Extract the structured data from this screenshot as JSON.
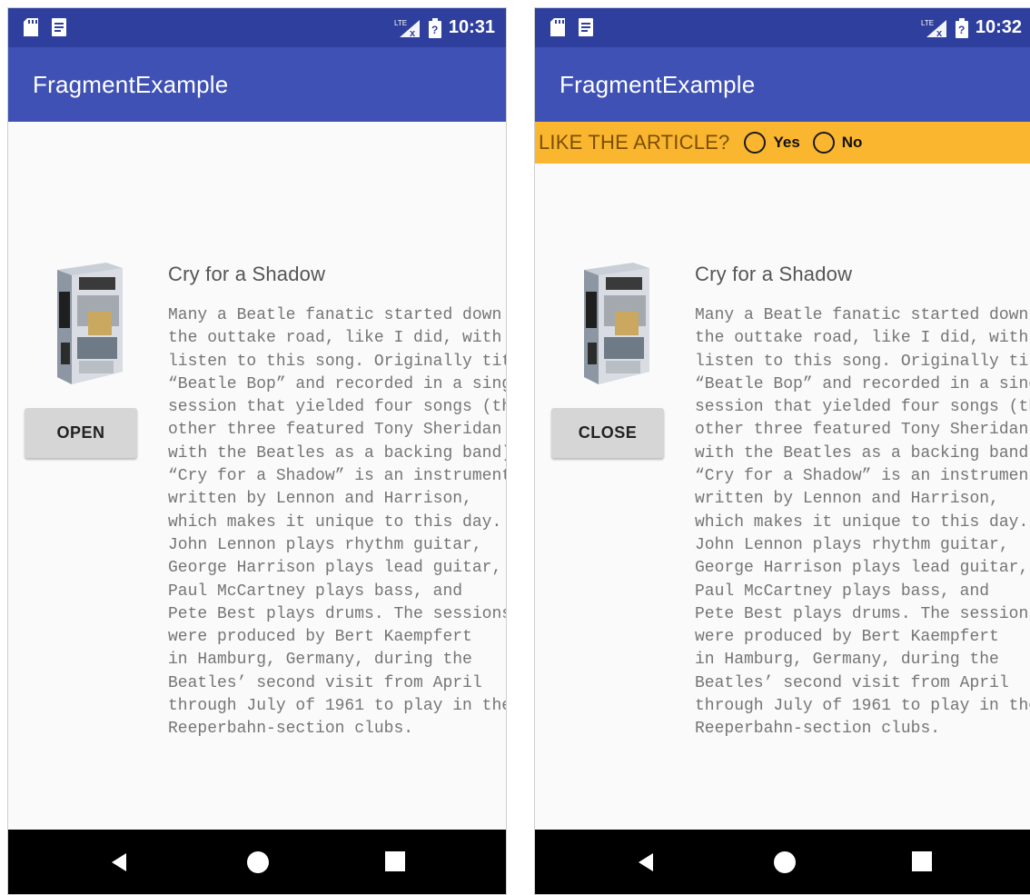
{
  "colors": {
    "status_bar": "#2e3f9e",
    "app_bar": "#3f51b5",
    "like_bar": "#fbb630",
    "nav_bar": "#000000",
    "button": "#d6d6d6"
  },
  "screens": [
    {
      "status_bar": {
        "time": "10:31",
        "icons": [
          "sd-card-icon",
          "notification-icon",
          "lte-signal-icon",
          "battery-icon"
        ]
      },
      "app_title": "FragmentExample",
      "button_label": "OPEN",
      "article": {
        "title": "Cry for a Shadow",
        "body": "Many a Beatle fanatic started down\nthe outtake road, like I did, with a first\nlisten to this song. Originally titled\n“Beatle Bop” and recorded in a single\nsession that yielded four songs (the\nother three featured Tony Sheridan\nwith the Beatles as a backing band),\n“Cry for a Shadow” is an instrumental\nwritten by Lennon and Harrison,\nwhich makes it unique to this day.\nJohn Lennon plays rhythm guitar,\nGeorge Harrison plays lead guitar,\nPaul McCartney plays bass, and\nPete Best plays drums. The sessions\nwere produced by Bert Kaempfert\nin Hamburg, Germany, during the\nBeatles’ second visit from April\nthrough July of 1961 to play in the\nReeperbahn-section clubs."
      },
      "nav_icons": [
        "back-icon",
        "home-icon",
        "recents-icon"
      ]
    },
    {
      "status_bar": {
        "time": "10:32",
        "icons": [
          "sd-card-icon",
          "notification-icon",
          "lte-signal-icon",
          "battery-icon"
        ]
      },
      "app_title": "FragmentExample",
      "fragment": {
        "prompt": "LIKE THE ARTICLE?",
        "options": [
          "Yes",
          "No"
        ]
      },
      "button_label": "CLOSE",
      "article": {
        "title": "Cry for a Shadow",
        "body": "Many a Beatle fanatic started down\nthe outtake road, like I did, with a first\nlisten to this song. Originally titled\n“Beatle Bop” and recorded in a single\nsession that yielded four songs (the\nother three featured Tony Sheridan\nwith the Beatles as a backing band),\n“Cry for a Shadow” is an instrumental\nwritten by Lennon and Harrison,\nwhich makes it unique to this day.\nJohn Lennon plays rhythm guitar,\nGeorge Harrison plays lead guitar,\nPaul McCartney plays bass, and\nPete Best plays drums. The sessions\nwere produced by Bert Kaempfert\nin Hamburg, Germany, during the\nBeatles’ second visit from April\nthrough July of 1961 to play in the\nReeperbahn-section clubs."
      },
      "nav_icons": [
        "back-icon",
        "home-icon",
        "recents-icon"
      ]
    }
  ]
}
